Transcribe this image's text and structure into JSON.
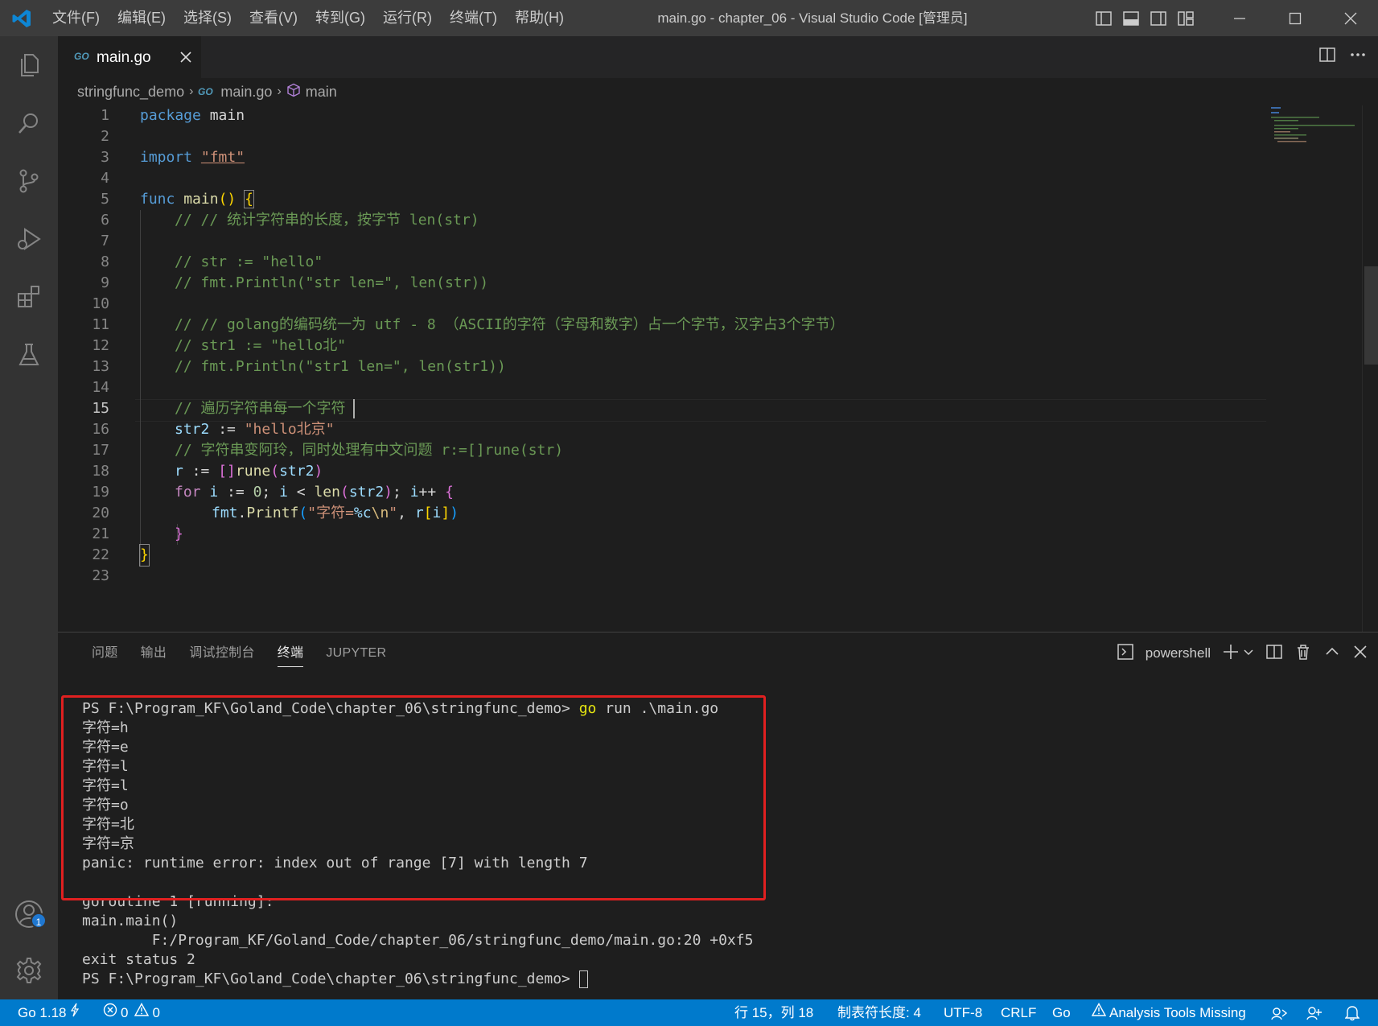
{
  "titlebar": {
    "menu": [
      "文件(F)",
      "编辑(E)",
      "选择(S)",
      "查看(V)",
      "转到(G)",
      "运行(R)",
      "终端(T)",
      "帮助(H)"
    ],
    "title": "main.go - chapter_06 - Visual Studio Code [管理员]"
  },
  "tab": {
    "label": "main.go",
    "icon": "go-file-icon"
  },
  "breadcrumb": {
    "folder": "stringfunc_demo",
    "file": "main.go",
    "symbol": "main"
  },
  "code": {
    "current_line": "15",
    "line_numbers": [
      "1",
      "2",
      "3",
      "4",
      "5",
      "6",
      "7",
      "8",
      "9",
      "10",
      "11",
      "12",
      "13",
      "14",
      "15",
      "16",
      "17",
      "18",
      "19",
      "20",
      "21",
      "22",
      "23"
    ],
    "l1": {
      "kw": "package",
      "rest": " main"
    },
    "l3": {
      "kw": "import",
      "str": "\"fmt\""
    },
    "l5": {
      "kw": "func",
      "fn": "main",
      "paren": "()",
      "brace": "{"
    },
    "l6": "// // 统计字符串的长度，按字节 len(str)",
    "l8": "// str := \"hello\"",
    "l9": "// fmt.Println(\"str len=\", len(str))",
    "l11": "// // golang的编码统一为 utf - 8 （ASCII的字符（字母和数字）占一个字节，汉字占3个字节）",
    "l12": "// str1 := \"hello北\"",
    "l13": "// fmt.Println(\"str1 len=\", len(str1))",
    "l15": "// 遍历字符串每一个字符",
    "l16": {
      "var": "str2",
      "op": " := ",
      "str": "\"hello北京\""
    },
    "l17": "// 字符串变阿玲，同时处理有中文问题 r:=[]rune(str)",
    "l18": {
      "var": "r",
      "op": " := ",
      "br": "[]",
      "type": "rune",
      "p1": "(",
      "arg": "str2",
      "p2": ")"
    },
    "l19": {
      "kw": "for",
      "v1": "i",
      "op1": " := ",
      "n0": "0",
      "semi1": "; ",
      "v2": "i",
      "op2": " < ",
      "fn": "len",
      "p1": "(",
      "arg": "str2",
      "p2": ")",
      "semi2": "; ",
      "v3": "i",
      "inc": "++ ",
      "brace": "{"
    },
    "l20": {
      "pkg": "fmt",
      "dot": ".",
      "fn": "Printf",
      "p1": "(",
      "s1": "\"字符=",
      "esc1": "%c",
      "esc2": "\\n",
      "s2": "\"",
      "comma": ", ",
      "v": "r",
      "b1": "[",
      "i": "i",
      "b2": "]",
      "p2": ")"
    },
    "l21": "}",
    "l22": "}"
  },
  "panel": {
    "tabs": [
      "问题",
      "输出",
      "调试控制台",
      "终端",
      "JUPYTER"
    ],
    "active_tab": "终端",
    "shell": "powershell"
  },
  "terminal": {
    "prompt1": "PS F:\\Program_KF\\Goland_Code\\chapter_06\\stringfunc_demo> ",
    "cmd_go": "go",
    "cmd_rest": " run .\\main.go",
    "output": [
      "字符=h",
      "字符=e",
      "字符=l",
      "字符=l",
      "字符=o",
      "字符=北",
      "字符=京"
    ],
    "panic": "panic: runtime error: index out of range [7] with length 7",
    "trace": [
      "goroutine 1 [running]:",
      "main.main()",
      "        F:/Program_KF/Goland_Code/chapter_06/stringfunc_demo/main.go:20 +0xf5",
      "exit status 2"
    ],
    "prompt2": "PS F:\\Program_KF\\Goland_Code\\chapter_06\\stringfunc_demo> "
  },
  "statusbar": {
    "go_version": "Go 1.18",
    "errors": "0",
    "warnings": "0",
    "position": "行 15，列 18",
    "tab_size": "制表符长度: 4",
    "encoding": "UTF-8",
    "eol": "CRLF",
    "language": "Go",
    "analysis": "Analysis Tools Missing"
  },
  "accounts_badge": "1",
  "colors": {
    "statusbar": "#007acc",
    "highlight_box": "#e02020",
    "accent": "#1f77d0"
  }
}
